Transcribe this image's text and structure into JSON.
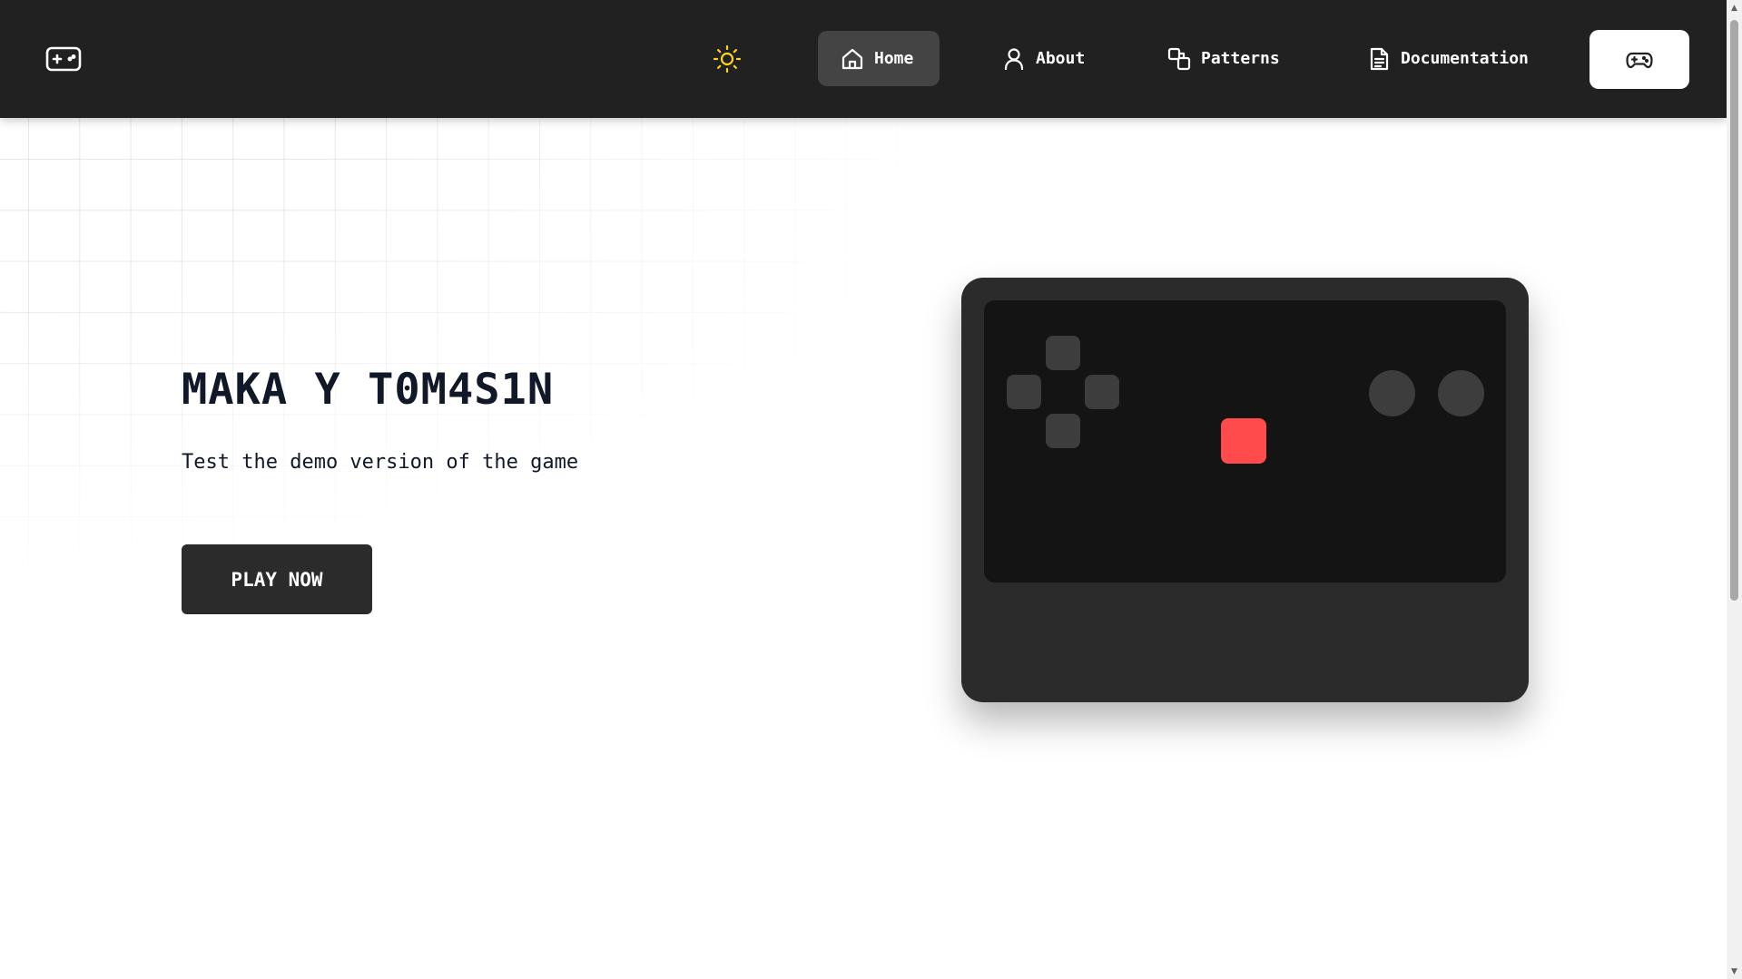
{
  "header": {
    "logo_icon": "gamepad-icon",
    "theme_toggle_icon": "sun-icon",
    "theme_toggle_color": "#FFD21F",
    "nav": [
      {
        "label": "Home",
        "icon": "home-icon",
        "active": true
      },
      {
        "label": "About",
        "icon": "user-icon",
        "active": false
      },
      {
        "label": "Patterns",
        "icon": "shapes-icon",
        "active": false
      },
      {
        "label": "Documentation",
        "icon": "document-icon",
        "active": false
      }
    ],
    "play_button_icon": "gamepad-icon"
  },
  "hero": {
    "title": "MAKA Y T0M4S1N",
    "subtitle": "Test the demo version of the game",
    "cta_label": "PLAY NOW"
  },
  "console": {
    "player_color": "#FF4B4B"
  },
  "colors": {
    "navbar_bg": "#212121",
    "active_nav_bg": "#444444",
    "button_bg": "#2B2B2B",
    "text_dark": "#111827"
  }
}
